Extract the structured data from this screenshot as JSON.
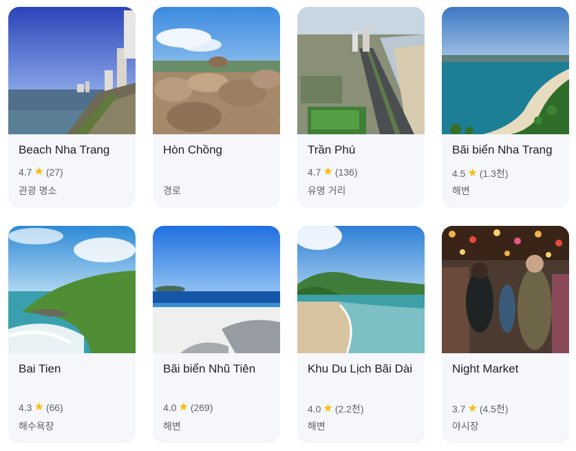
{
  "places": [
    {
      "name": "Beach Nha Trang",
      "rating": "4.7",
      "reviews": "(27)",
      "category": "관광 명소",
      "image": "beach-city-seawall-photo"
    },
    {
      "name": "Hòn Chồng",
      "rating": "",
      "reviews": "",
      "category": "경로",
      "image": "rock-formation-photo"
    },
    {
      "name": "Trần Phú",
      "rating": "4.7",
      "reviews": "(136)",
      "category": "유명 거리",
      "image": "aerial-boulevard-photo"
    },
    {
      "name": "Bãi biển Nha Trang",
      "rating": "4.5",
      "reviews": "(1.3천)",
      "category": "해변",
      "image": "bay-aerial-photo"
    },
    {
      "name": "Bai Tien",
      "rating": "4.3",
      "reviews": "(66)",
      "category": "해수욕장",
      "image": "cove-headland-photo"
    },
    {
      "name": "Bãi biển Nhũ Tiên",
      "rating": "4.0",
      "reviews": "(269)",
      "category": "해변",
      "image": "white-sand-beach-photo"
    },
    {
      "name": "Khu Du Lịch Bãi Dài",
      "rating": "4.0",
      "reviews": "(2.2천)",
      "category": "해변",
      "image": "long-beach-hills-photo"
    },
    {
      "name": "Night Market",
      "rating": "3.7",
      "reviews": "(4.5천)",
      "category": "야시장",
      "image": "night-market-lanterns-photo"
    }
  ],
  "star_glyph": "★",
  "colors": {
    "star": "#fbbc04",
    "card_bg": "#f5f7fa",
    "title": "#202124",
    "meta": "#5f6368"
  }
}
